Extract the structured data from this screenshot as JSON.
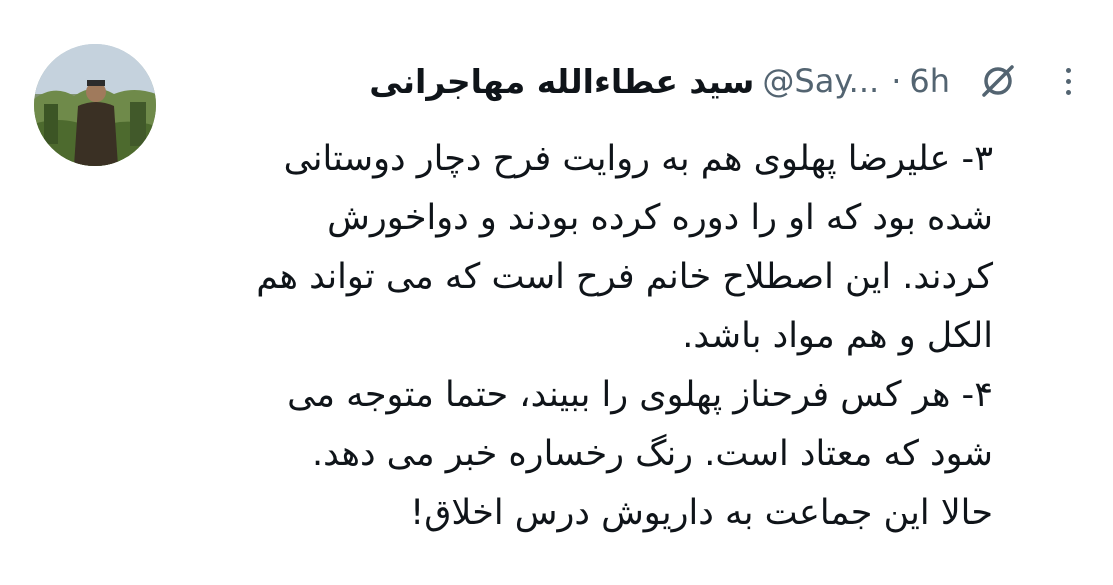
{
  "tweet": {
    "author_name": "سید عطاءالله مهاجرانی",
    "handle": "@Say...",
    "separator": "·",
    "time": "6h",
    "grok_icon": "grok-icon",
    "more_icon": "more-icon",
    "lines": [
      "۳- علیرضا پهلوی هم به روایت فرح دچار دوستانی",
      "شده بود که او را دوره کرده بودند و دواخورش",
      "کردند. این اصطلاح خانم فرح است که می تواند هم",
      "الکل و هم مواد باشد.",
      "۴- هر کس فرحناز پهلوی را ببیند، حتما متوجه می",
      "شود که معتاد است. رنگ رخساره خبر می دهد.",
      "حالا این جماعت به داریوش درس اخلاق!"
    ]
  }
}
